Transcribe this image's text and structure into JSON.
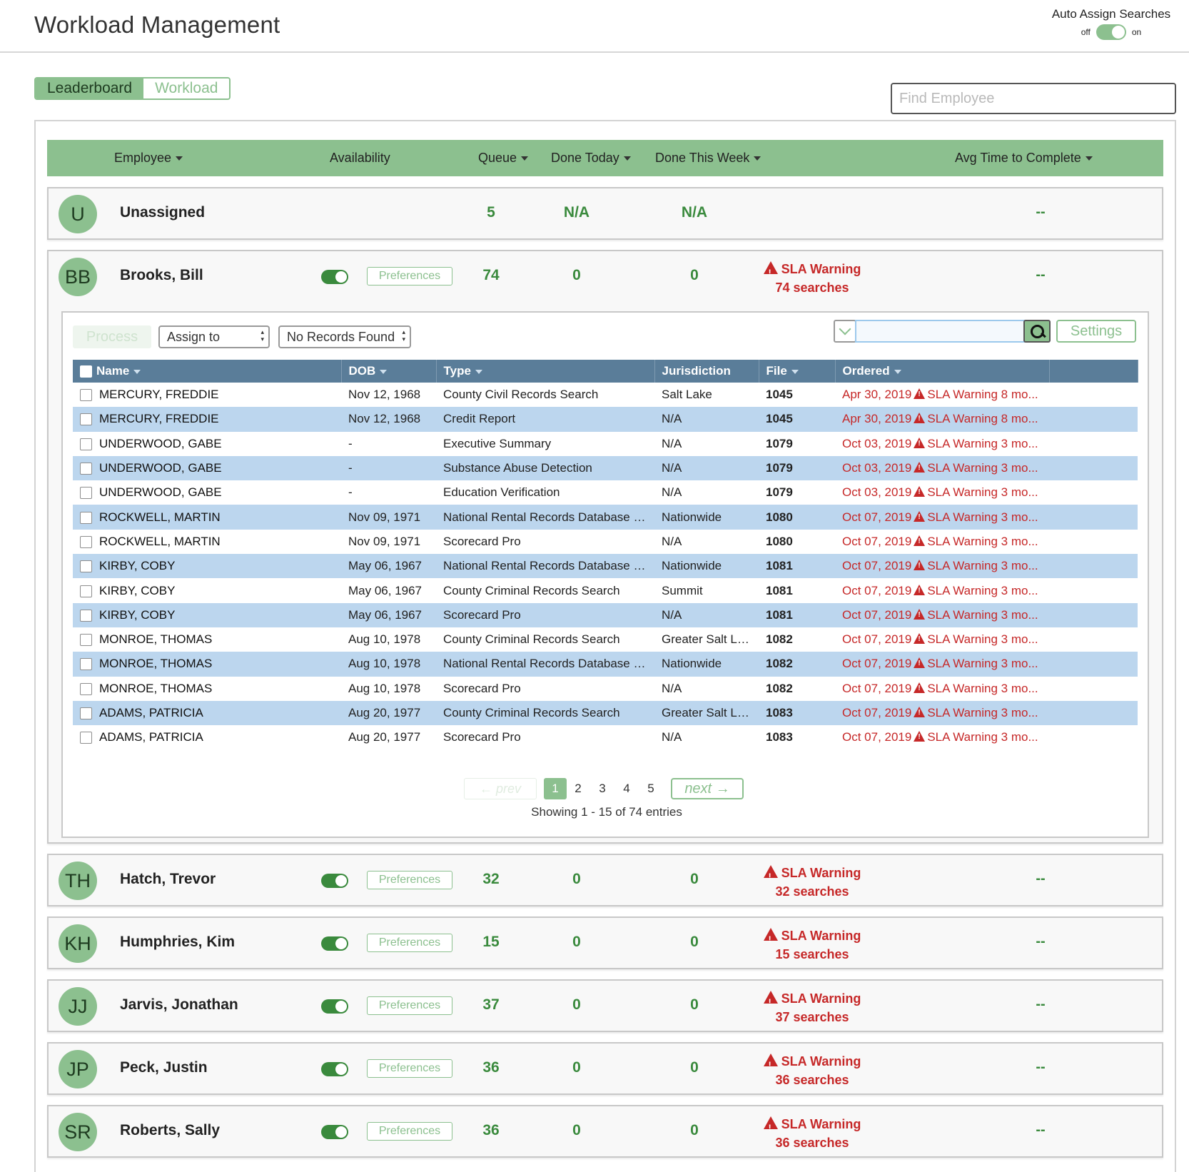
{
  "header": {
    "title": "Workload Management",
    "auto_assign_label": "Auto Assign Searches",
    "off_label": "off",
    "on_label": "on"
  },
  "tabs": {
    "leaderboard": "Leaderboard",
    "workload": "Workload"
  },
  "find_placeholder": "Find Employee",
  "columns": {
    "employee": "Employee",
    "availability": "Availability",
    "queue": "Queue",
    "done_today": "Done Today",
    "done_week": "Done This Week",
    "avg_time": "Avg Time to Complete"
  },
  "prefs_label": "Preferences",
  "employees": [
    {
      "initials": "U",
      "name": "Unassigned",
      "queue": "5",
      "done_today": "N/A",
      "done_week": "N/A",
      "sla_title": "",
      "sla_sub": "",
      "avg": "--"
    },
    {
      "initials": "BB",
      "name": "Brooks, Bill",
      "queue": "74",
      "done_today": "0",
      "done_week": "0",
      "sla_title": "SLA Warning",
      "sla_sub": "74 searches",
      "avg": "--"
    },
    {
      "initials": "TH",
      "name": "Hatch, Trevor",
      "queue": "32",
      "done_today": "0",
      "done_week": "0",
      "sla_title": "SLA Warning",
      "sla_sub": "32 searches",
      "avg": "--"
    },
    {
      "initials": "KH",
      "name": "Humphries, Kim",
      "queue": "15",
      "done_today": "0",
      "done_week": "0",
      "sla_title": "SLA Warning",
      "sla_sub": "15 searches",
      "avg": "--"
    },
    {
      "initials": "JJ",
      "name": "Jarvis, Jonathan",
      "queue": "37",
      "done_today": "0",
      "done_week": "0",
      "sla_title": "SLA Warning",
      "sla_sub": "37 searches",
      "avg": "--"
    },
    {
      "initials": "JP",
      "name": "Peck, Justin",
      "queue": "36",
      "done_today": "0",
      "done_week": "0",
      "sla_title": "SLA Warning",
      "sla_sub": "36 searches",
      "avg": "--"
    },
    {
      "initials": "SR",
      "name": "Roberts, Sally",
      "queue": "36",
      "done_today": "0",
      "done_week": "0",
      "sla_title": "SLA Warning",
      "sla_sub": "36 searches",
      "avg": "--"
    }
  ],
  "detail": {
    "process_label": "Process",
    "assign_label": "Assign to",
    "records_label": "No Records Found",
    "settings_label": "Settings",
    "columns": {
      "name": "Name",
      "dob": "DOB",
      "type": "Type",
      "jurisdiction": "Jurisdiction",
      "file": "File",
      "ordered": "Ordered"
    },
    "rows": [
      {
        "name": "MERCURY, FREDDIE",
        "dob": "Nov 12, 1968",
        "type": "County Civil Records Search",
        "jurisdiction": "Salt Lake",
        "file": "1045",
        "date": "Apr 30, 2019",
        "warning": "SLA Warning 8 mo..."
      },
      {
        "name": "MERCURY, FREDDIE",
        "dob": "Nov 12, 1968",
        "type": "Credit Report",
        "jurisdiction": "N/A",
        "file": "1045",
        "date": "Apr 30, 2019",
        "warning": "SLA Warning 8 mo..."
      },
      {
        "name": "UNDERWOOD, GABE",
        "dob": "-",
        "type": "Executive Summary",
        "jurisdiction": "N/A",
        "file": "1079",
        "date": "Oct 03, 2019",
        "warning": "SLA Warning 3 mo..."
      },
      {
        "name": "UNDERWOOD, GABE",
        "dob": "-",
        "type": "Substance Abuse Detection",
        "jurisdiction": "N/A",
        "file": "1079",
        "date": "Oct 03, 2019",
        "warning": "SLA Warning 3 mo..."
      },
      {
        "name": "UNDERWOOD, GABE",
        "dob": "-",
        "type": "Education Verification",
        "jurisdiction": "N/A",
        "file": "1079",
        "date": "Oct 03, 2019",
        "warning": "SLA Warning 3 mo..."
      },
      {
        "name": "ROCKWELL, MARTIN",
        "dob": "Nov 09, 1971",
        "type": "National Rental Records Database S...",
        "jurisdiction": "Nationwide",
        "file": "1080",
        "date": "Oct 07, 2019",
        "warning": "SLA Warning 3 mo..."
      },
      {
        "name": "ROCKWELL, MARTIN",
        "dob": "Nov 09, 1971",
        "type": "Scorecard Pro",
        "jurisdiction": "N/A",
        "file": "1080",
        "date": "Oct 07, 2019",
        "warning": "SLA Warning 3 mo..."
      },
      {
        "name": "KIRBY, COBY",
        "dob": "May 06, 1967",
        "type": "National Rental Records Database S...",
        "jurisdiction": "Nationwide",
        "file": "1081",
        "date": "Oct 07, 2019",
        "warning": "SLA Warning 3 mo..."
      },
      {
        "name": "KIRBY, COBY",
        "dob": "May 06, 1967",
        "type": "County Criminal Records Search",
        "jurisdiction": "Summit",
        "file": "1081",
        "date": "Oct 07, 2019",
        "warning": "SLA Warning 3 mo..."
      },
      {
        "name": "KIRBY, COBY",
        "dob": "May 06, 1967",
        "type": "Scorecard Pro",
        "jurisdiction": "N/A",
        "file": "1081",
        "date": "Oct 07, 2019",
        "warning": "SLA Warning 3 mo..."
      },
      {
        "name": "MONROE, THOMAS",
        "dob": "Aug 10, 1978",
        "type": "County Criminal Records Search",
        "jurisdiction": "Greater Salt Lak...",
        "file": "1082",
        "date": "Oct 07, 2019",
        "warning": "SLA Warning 3 mo..."
      },
      {
        "name": "MONROE, THOMAS",
        "dob": "Aug 10, 1978",
        "type": "National Rental Records Database S...",
        "jurisdiction": "Nationwide",
        "file": "1082",
        "date": "Oct 07, 2019",
        "warning": "SLA Warning 3 mo..."
      },
      {
        "name": "MONROE, THOMAS",
        "dob": "Aug 10, 1978",
        "type": "Scorecard Pro",
        "jurisdiction": "N/A",
        "file": "1082",
        "date": "Oct 07, 2019",
        "warning": "SLA Warning 3 mo..."
      },
      {
        "name": "ADAMS, PATRICIA",
        "dob": "Aug 20, 1977",
        "type": "County Criminal Records Search",
        "jurisdiction": "Greater Salt Lak...",
        "file": "1083",
        "date": "Oct 07, 2019",
        "warning": "SLA Warning 3 mo..."
      },
      {
        "name": "ADAMS, PATRICIA",
        "dob": "Aug 20, 1977",
        "type": "Scorecard Pro",
        "jurisdiction": "N/A",
        "file": "1083",
        "date": "Oct 07, 2019",
        "warning": "SLA Warning 3 mo..."
      }
    ],
    "pagination": {
      "prev": "prev",
      "next": "next",
      "pages": [
        "1",
        "2",
        "3",
        "4",
        "5"
      ],
      "current": "1",
      "info": "Showing 1 - 15 of 74 entries"
    }
  },
  "colors": {
    "accent_green": "#8cc08f",
    "value_green": "#3a8a3d",
    "warning_red": "#c62828",
    "table_header": "#5a7d99",
    "row_alt": "#bcd6ee"
  }
}
